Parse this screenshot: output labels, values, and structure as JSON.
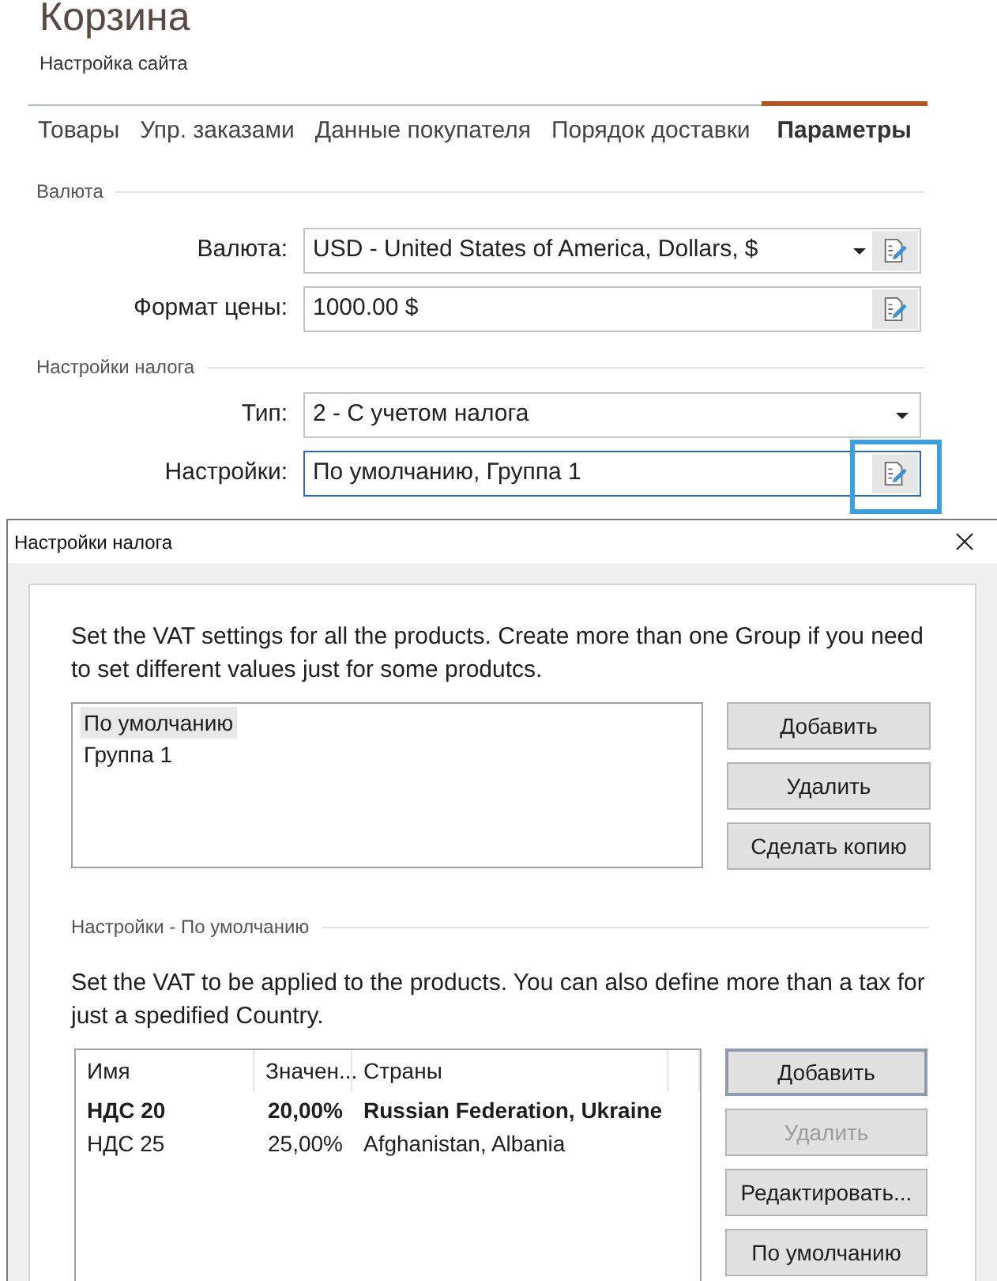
{
  "page": {
    "title": "Корзина",
    "subtitle": "Настройка сайта"
  },
  "tabs": [
    {
      "label": "Товары",
      "selected": false
    },
    {
      "label": "Упр. заказами",
      "selected": false
    },
    {
      "label": "Данные покупателя",
      "selected": false
    },
    {
      "label": "Порядок доставки",
      "selected": false
    },
    {
      "label": "Параметры",
      "selected": true
    }
  ],
  "sections": [
    {
      "title": "Валюта",
      "fields": [
        {
          "label": "Валюта:",
          "kind": "dropdown",
          "value": "USD - United States of America, Dollars, $",
          "edit_button": true,
          "focused": false,
          "highlighted": false
        },
        {
          "label": "Формат цены:",
          "kind": "text",
          "value": "1000.00 $",
          "edit_button": true,
          "focused": false,
          "highlighted": false
        }
      ]
    },
    {
      "title": "Настройки налога",
      "fields": [
        {
          "label": "Тип:",
          "kind": "dropdown",
          "value": "2 - С учетом налога",
          "edit_button": false,
          "focused": false,
          "highlighted": false
        },
        {
          "label": "Настройки:",
          "kind": "text",
          "value": "По умолчанию, Группа 1",
          "edit_button": true,
          "focused": true,
          "highlighted": true
        }
      ]
    }
  ],
  "dialog": {
    "title": "Настройки налога",
    "intro": "Set the VAT settings for all the products. Create more than one Group if you need to set different values just for some produtcs.",
    "groups": [
      {
        "label": "По умолчанию",
        "selected": true
      },
      {
        "label": "Группа 1",
        "selected": false
      }
    ],
    "group_buttons": [
      {
        "label": "Добавить",
        "disabled": false,
        "default": false
      },
      {
        "label": "Удалить",
        "disabled": false,
        "default": false
      },
      {
        "label": "Сделать копию",
        "disabled": false,
        "default": false
      }
    ],
    "settings_title": "Настройки - По умолчанию",
    "settings_intro": "Set the VAT to be applied to the products. You can also define more than a tax for just a spedified Country.",
    "taxes": {
      "columns": [
        "Имя",
        "Значен...",
        "Страны"
      ],
      "rows": [
        {
          "cells": [
            "НДС 20",
            "20,00%",
            "Russian Federation, Ukraine"
          ],
          "emphasized": true
        },
        {
          "cells": [
            "НДС 25",
            "25,00%",
            "Afghanistan, Albania"
          ],
          "emphasized": false
        }
      ]
    },
    "tax_buttons": [
      {
        "label": "Добавить",
        "disabled": false,
        "default": true
      },
      {
        "label": "Удалить",
        "disabled": true,
        "default": false
      },
      {
        "label": "Редактировать...",
        "disabled": false,
        "default": false
      },
      {
        "label": "По умолчанию",
        "disabled": false,
        "default": false
      }
    ]
  }
}
